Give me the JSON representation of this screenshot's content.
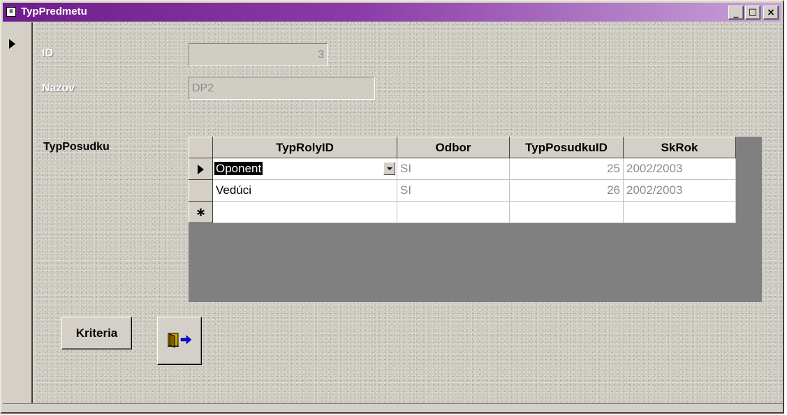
{
  "window": {
    "title": "TypPredmetu",
    "controls": [
      "_",
      "□",
      "×"
    ]
  },
  "form": {
    "id": {
      "label": "ID",
      "value": "3"
    },
    "nazov": {
      "label": "Nazov",
      "value": "DP2"
    },
    "subform_label": "TypPosudku"
  },
  "grid": {
    "columns": [
      "TypRolyID",
      "Odbor",
      "TypPosudkuID",
      "SkRok"
    ],
    "rows": [
      {
        "typroly": "Oponent",
        "odbor": "SI",
        "typposudku": "25",
        "skrok": "2002/2003"
      },
      {
        "typroly": "Vedúci",
        "odbor": "SI",
        "typposudku": "26",
        "skrok": "2002/2003"
      }
    ],
    "new_row_marker": "∗"
  },
  "buttons": {
    "kriteria": "Kriteria",
    "exit_icon": "exit-door-icon"
  },
  "colors": {
    "titlebar_start": "#6e1e8c",
    "titlebar_end": "#c8a3d8",
    "subform_background": "#808080"
  }
}
